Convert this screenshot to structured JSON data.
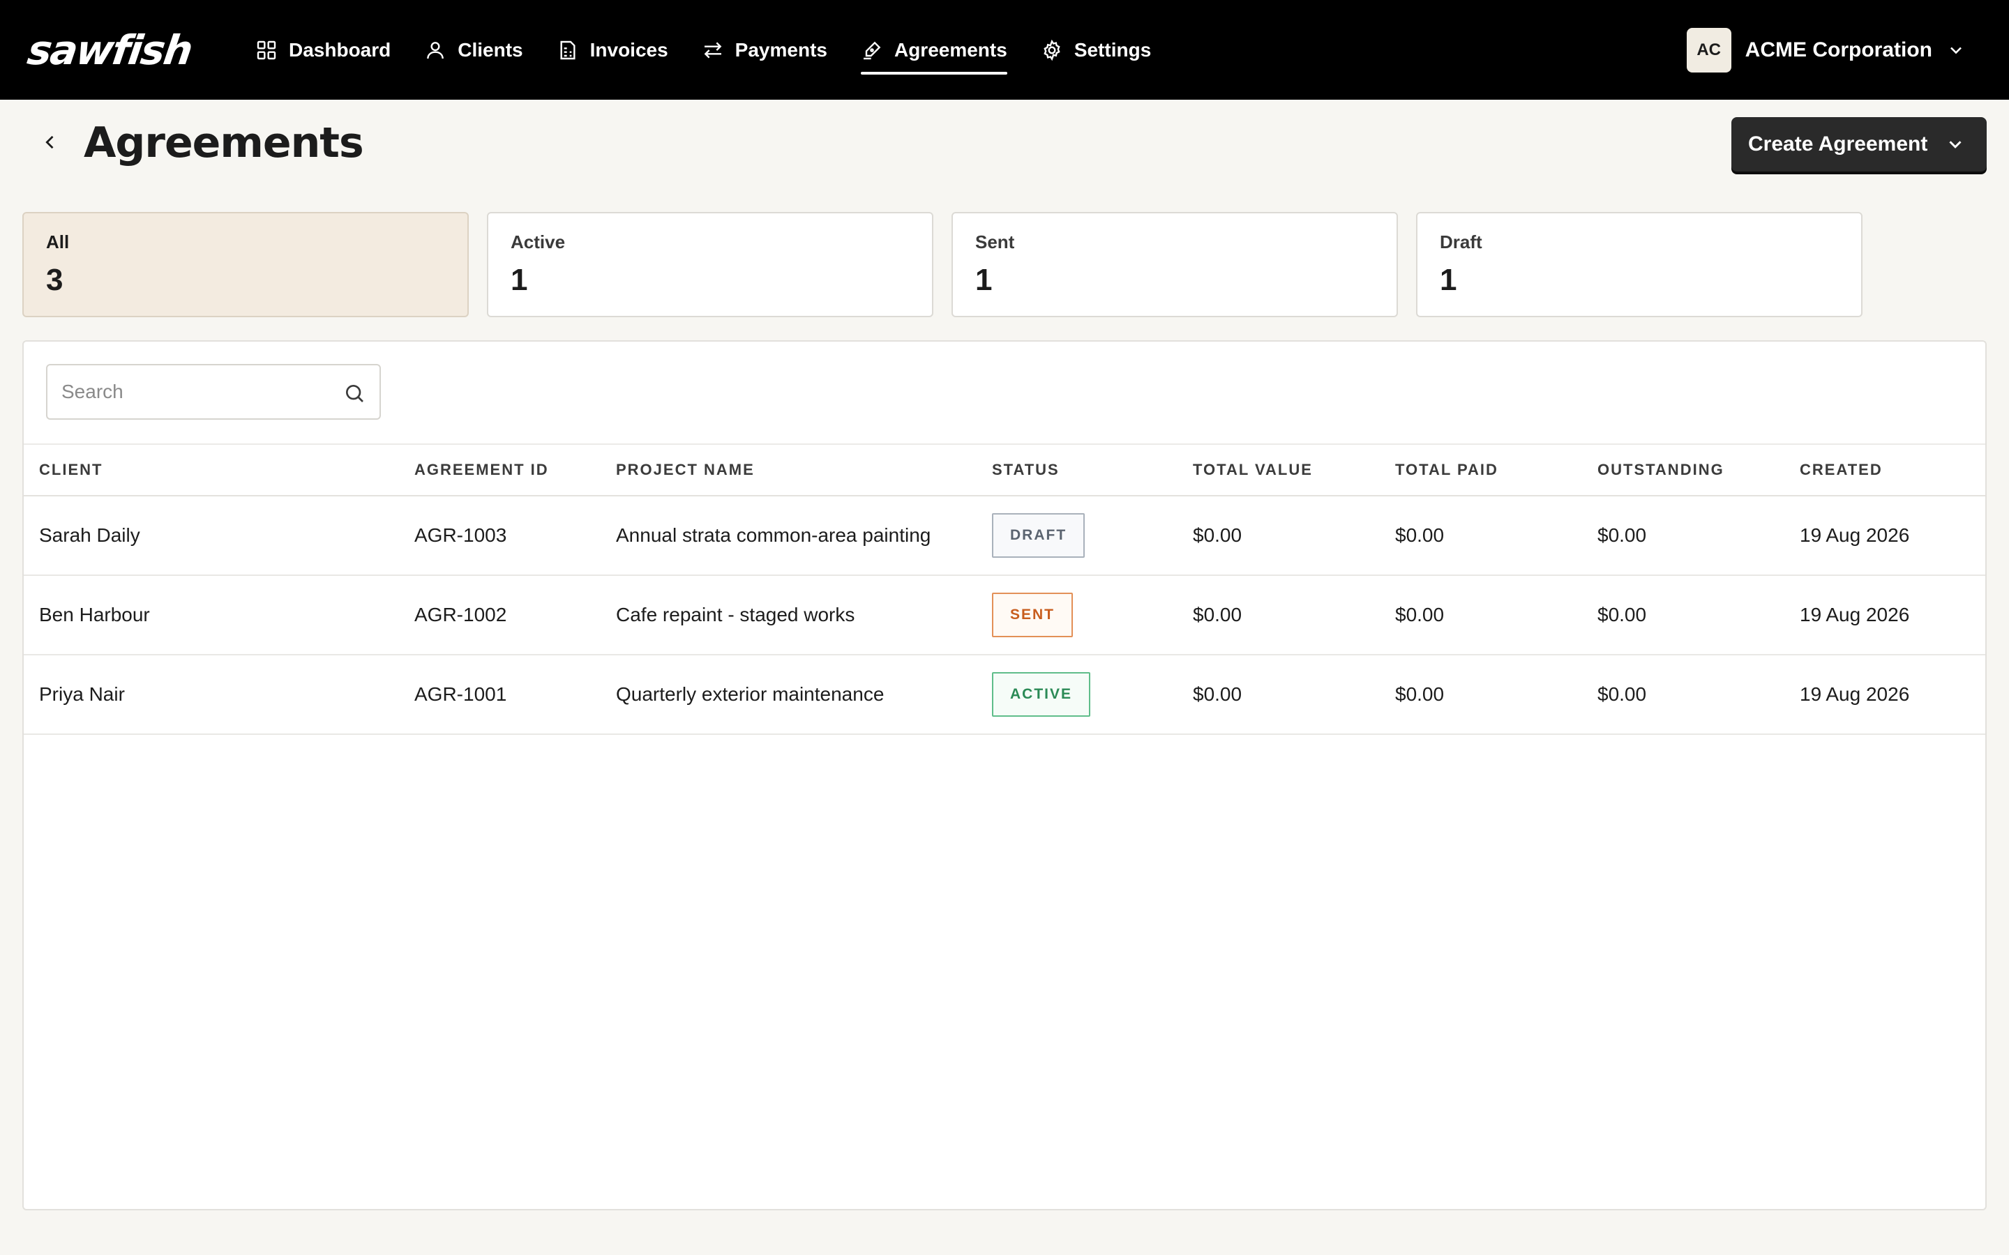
{
  "app": {
    "logo_text": "sawfish"
  },
  "nav": {
    "items": [
      {
        "label": "Dashboard",
        "icon": "dashboard-grid-icon"
      },
      {
        "label": "Clients",
        "icon": "user-icon"
      },
      {
        "label": "Invoices",
        "icon": "invoice-icon"
      },
      {
        "label": "Payments",
        "icon": "transfer-arrows-icon"
      },
      {
        "label": "Agreements",
        "icon": "pen-sign-icon",
        "active": true
      },
      {
        "label": "Settings",
        "icon": "gear-icon"
      }
    ]
  },
  "org": {
    "initials": "AC",
    "name": "ACME Corporation"
  },
  "page": {
    "title": "Agreements",
    "create_label": "Create Agreement"
  },
  "stats": [
    {
      "label": "All",
      "value": "3"
    },
    {
      "label": "Active",
      "value": "1"
    },
    {
      "label": "Sent",
      "value": "1"
    },
    {
      "label": "Draft",
      "value": "1"
    }
  ],
  "search": {
    "placeholder": "Search",
    "value": ""
  },
  "table": {
    "headers": [
      "CLIENT",
      "AGREEMENT ID",
      "PROJECT NAME",
      "STATUS",
      "TOTAL VALUE",
      "TOTAL PAID",
      "OUTSTANDING",
      "CREATED"
    ],
    "rows": [
      {
        "client": "Sarah Daily",
        "id": "AGR-1003",
        "project": "Annual strata common-area painting",
        "status": "DRAFT",
        "total_value": "$0.00",
        "total_paid": "$0.00",
        "outstanding": "$0.00",
        "created": "19 Aug 2026"
      },
      {
        "client": "Ben Harbour",
        "id": "AGR-1002",
        "project": "Cafe repaint - staged works",
        "status": "SENT",
        "total_value": "$0.00",
        "total_paid": "$0.00",
        "outstanding": "$0.00",
        "created": "19 Aug 2026"
      },
      {
        "client": "Priya Nair",
        "id": "AGR-1001",
        "project": "Quarterly exterior maintenance",
        "status": "ACTIVE",
        "total_value": "$0.00",
        "total_paid": "$0.00",
        "outstanding": "$0.00",
        "created": "19 Aug 2026"
      }
    ]
  },
  "colors": {
    "topbar": "#000000",
    "background": "#f7f6f2",
    "selected_card": "#f3ebe0",
    "draft": "#5b6470",
    "sent": "#c85d1e",
    "active": "#2b8a56"
  }
}
